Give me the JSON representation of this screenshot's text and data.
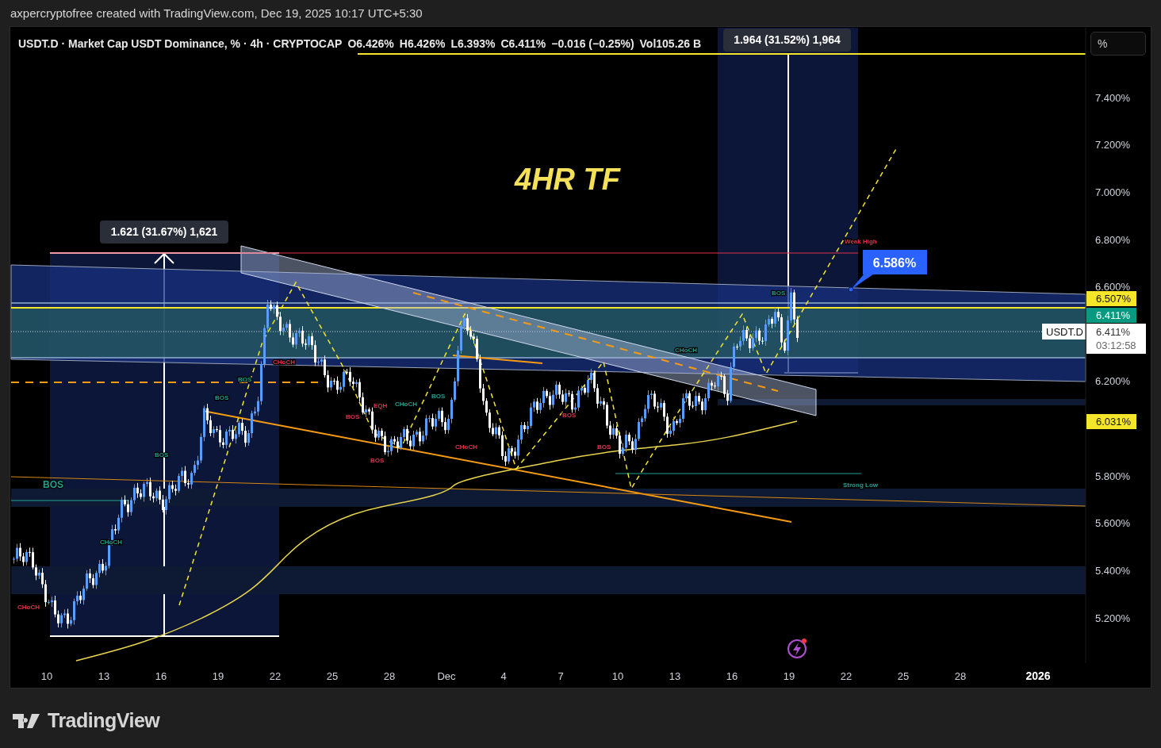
{
  "header": {
    "text": "axpercryptofree created with TradingView.com, Dec 19, 2025 10:17 UTC+5:30"
  },
  "legend": {
    "symbol": "USDT.D · Market Cap USDT Dominance, % · 4h · CRYPTOCAP",
    "fields": [
      "O6.426%",
      "H6.426%",
      "L6.393%",
      "C6.411%",
      "−0.016 (−0.25%)",
      "Vol105.26 B"
    ]
  },
  "scale_mode_button": {
    "label": "%"
  },
  "chart_title": "4HR TF",
  "measurements": [
    {
      "label": "1.621 (31.67%) 1,621"
    },
    {
      "label": "1.964 (31.52%) 1,964"
    }
  ],
  "callout": {
    "label": "6.586%"
  },
  "annotations": [
    {
      "text": "BOS",
      "kind": "bullish"
    },
    {
      "text": "CHoCH",
      "kind": "bearish"
    },
    {
      "text": "CHoCH",
      "kind": "bullish"
    },
    {
      "text": "BOS",
      "kind": "bullish"
    },
    {
      "text": "BOS",
      "kind": "bullish"
    },
    {
      "text": "BOS",
      "kind": "bullish"
    },
    {
      "text": "CHoCH",
      "kind": "bearish"
    },
    {
      "text": "BOS",
      "kind": "bearish"
    },
    {
      "text": "EQH",
      "kind": "bearish"
    },
    {
      "text": "CHoCH",
      "kind": "bullish"
    },
    {
      "text": "BOS",
      "kind": "bullish"
    },
    {
      "text": "BOS",
      "kind": "bearish"
    },
    {
      "text": "CHoCH",
      "kind": "bearish"
    },
    {
      "text": "BOS",
      "kind": "bearish"
    },
    {
      "text": "BOS",
      "kind": "bearish"
    },
    {
      "text": "CHoCH",
      "kind": "bullish"
    },
    {
      "text": "BOS",
      "kind": "bullish"
    },
    {
      "text": "Weak High",
      "kind": "bearish"
    },
    {
      "text": "Strong Low",
      "kind": "bullish"
    }
  ],
  "price_axis": {
    "labels": [
      "7.400%",
      "7.200%",
      "7.000%",
      "6.800%",
      "6.600%",
      "6.200%",
      "5.800%",
      "5.600%",
      "5.400%",
      "5.200%"
    ],
    "tags": [
      {
        "kind": "level",
        "text": "6.507%"
      },
      {
        "kind": "change",
        "text": "6.411%"
      },
      {
        "kind": "last",
        "symbol": "USDT.D",
        "price": "6.411%",
        "countdown": "03:12:58"
      },
      {
        "kind": "level",
        "text": "6.031%"
      }
    ]
  },
  "time_axis": {
    "labels": [
      {
        "text": "10",
        "major": false
      },
      {
        "text": "13",
        "major": false
      },
      {
        "text": "16",
        "major": false
      },
      {
        "text": "19",
        "major": false
      },
      {
        "text": "22",
        "major": false
      },
      {
        "text": "25",
        "major": false
      },
      {
        "text": "28",
        "major": false
      },
      {
        "text": "Dec",
        "major": false
      },
      {
        "text": "4",
        "major": false
      },
      {
        "text": "7",
        "major": false
      },
      {
        "text": "10",
        "major": false
      },
      {
        "text": "13",
        "major": false
      },
      {
        "text": "16",
        "major": false
      },
      {
        "text": "19",
        "major": false
      },
      {
        "text": "22",
        "major": false
      },
      {
        "text": "25",
        "major": false
      },
      {
        "text": "28",
        "major": false
      },
      {
        "text": "2026",
        "major": true
      }
    ]
  },
  "footer": {
    "brand": "TradingView"
  }
}
